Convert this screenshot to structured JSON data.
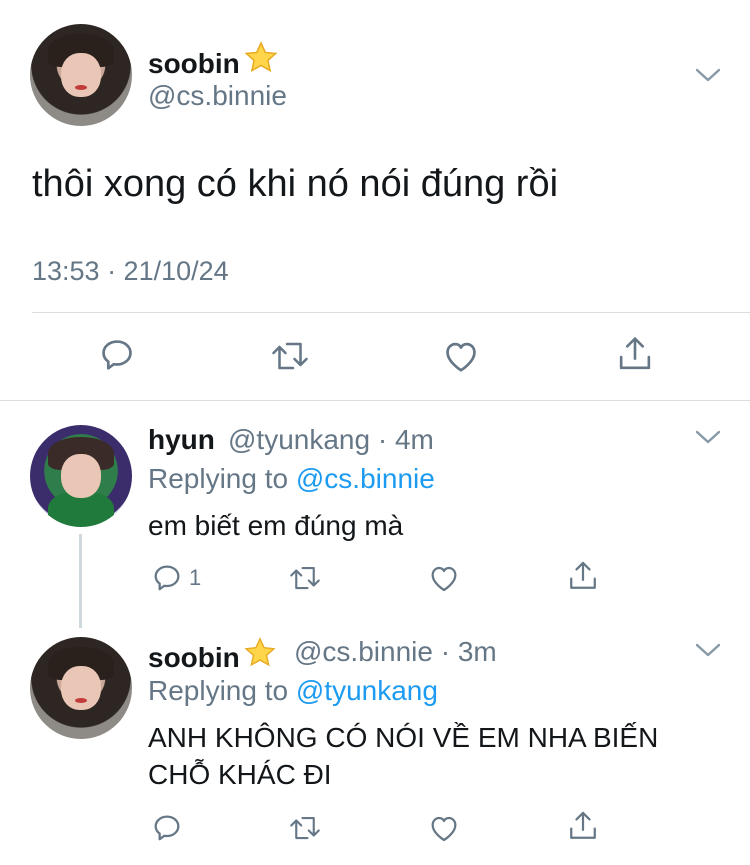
{
  "main_tweet": {
    "author_name": "soobin",
    "author_handle": "@cs.binnie",
    "text": "thôi xong có khi nó nói đúng rồi",
    "timestamp": "13:53 · 21/10/24"
  },
  "replies": [
    {
      "author_name": "hyun",
      "author_handle": "@tyunkang",
      "time_ago": "· 4m",
      "replying_label": "Replying to",
      "replying_to": "@cs.binnie",
      "text": "em biết em đúng mà",
      "reply_count": "1"
    },
    {
      "author_name": "soobin",
      "author_handle": "@cs.binnie",
      "time_ago": "· 3m",
      "replying_label": "Replying to",
      "replying_to": "@tyunkang",
      "text_line1": "ANH KHÔNG CÓ NÓI VỀ EM NHA BIẾN",
      "text_line2": "CHỖ KHÁC ĐI"
    }
  ],
  "icons": [
    "reply-icon",
    "retweet-icon",
    "like-icon",
    "share-icon",
    "chevron-down-icon",
    "star-emoji"
  ],
  "colors": {
    "text": "#14171a",
    "muted": "#657786",
    "link": "#1d9bf0",
    "divider": "#d9dee2"
  }
}
